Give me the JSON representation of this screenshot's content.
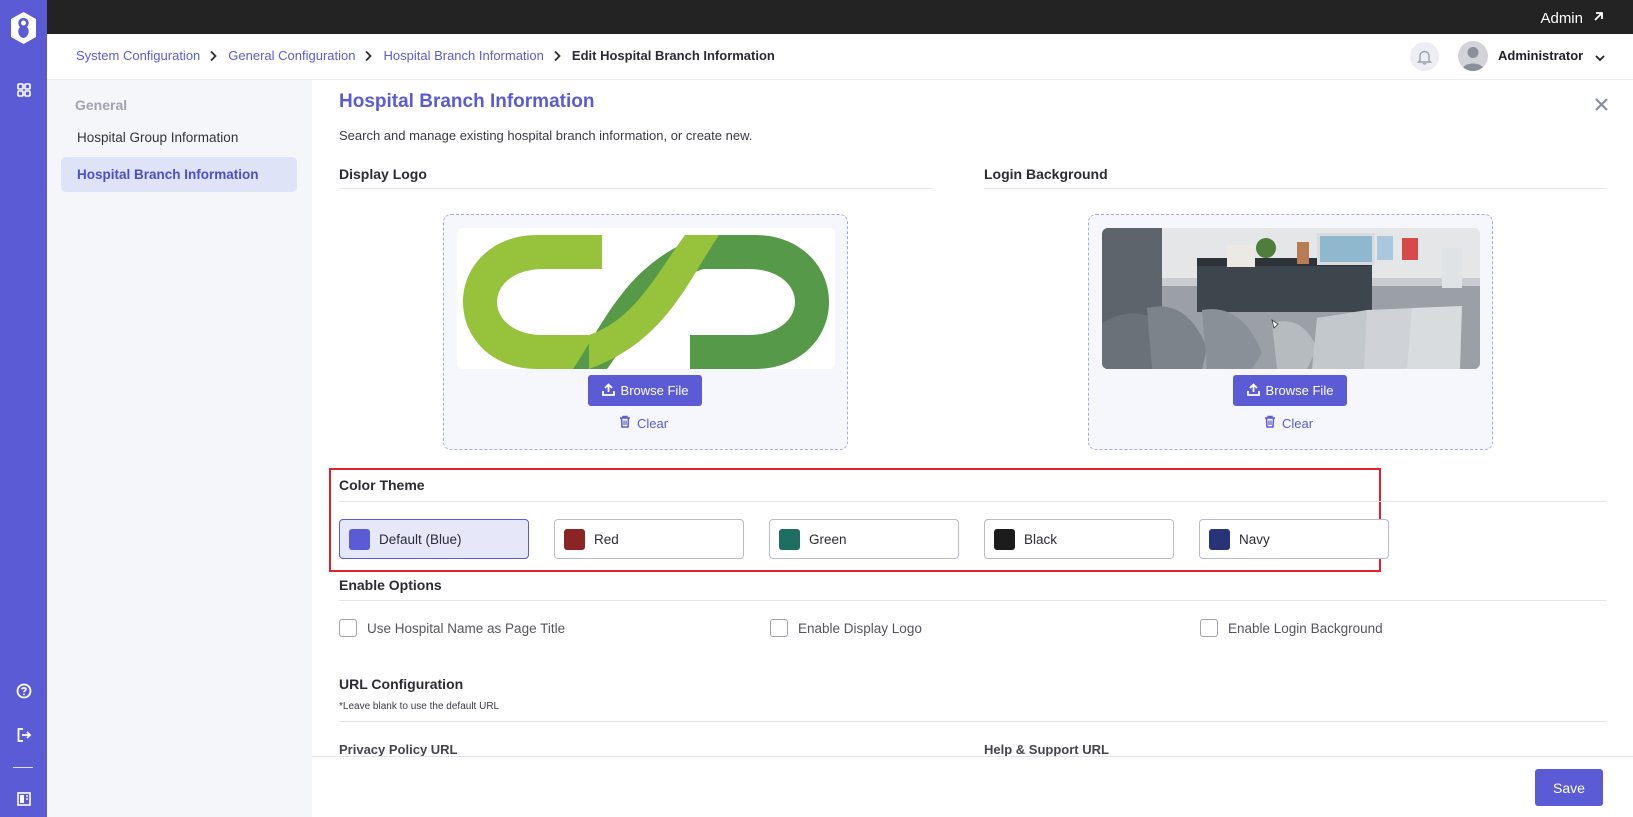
{
  "topbar": {
    "user_link": "Admin"
  },
  "breadcrumb": [
    "System Configuration",
    "General Configuration",
    "Hospital Branch Information",
    "Edit Hospital Branch Information"
  ],
  "header": {
    "username": "Administrator"
  },
  "sidebar": {
    "section": "General",
    "items": [
      {
        "label": "Hospital Group Information",
        "active": false
      },
      {
        "label": "Hospital Branch Information",
        "active": true
      }
    ]
  },
  "page": {
    "title": "Hospital Branch Information",
    "subtitle": "Search and manage existing hospital branch information, or create new."
  },
  "display_logo": {
    "heading": "Display Logo",
    "browse_label": "Browse File",
    "clear_label": "Clear"
  },
  "login_background": {
    "heading": "Login Background",
    "browse_label": "Browse File",
    "clear_label": "Clear"
  },
  "color_theme": {
    "heading": "Color Theme",
    "options": [
      {
        "label": "Default (Blue)",
        "color": "#5b5bd6",
        "selected": true
      },
      {
        "label": "Red",
        "color": "#8b2424",
        "selected": false
      },
      {
        "label": "Green",
        "color": "#1f6e62",
        "selected": false
      },
      {
        "label": "Black",
        "color": "#1c1c1c",
        "selected": false
      },
      {
        "label": "Navy",
        "color": "#27347a",
        "selected": false
      }
    ]
  },
  "enable_options": {
    "heading": "Enable Options",
    "items": [
      {
        "label": "Use Hospital Name as Page Title",
        "checked": false
      },
      {
        "label": "Enable Display Logo",
        "checked": false
      },
      {
        "label": "Enable Login Background",
        "checked": false
      }
    ]
  },
  "url_configuration": {
    "heading": "URL Configuration",
    "note": "*Leave blank to use the default URL",
    "privacy_label": "Privacy Policy URL",
    "help_label": "Help & Support URL"
  },
  "footer": {
    "save_label": "Save"
  },
  "icons": [
    "app-logo-icon",
    "grid-icon",
    "help-icon",
    "logout-icon",
    "panel-icon",
    "external-link-icon",
    "chevron-right-icon",
    "bell-icon",
    "user-avatar-icon",
    "chevron-down-icon",
    "close-icon",
    "upload-icon",
    "trash-icon"
  ],
  "colors": {
    "accent": "#5b5bd6",
    "topbar": "#232323",
    "highlight": "#e0202a"
  }
}
